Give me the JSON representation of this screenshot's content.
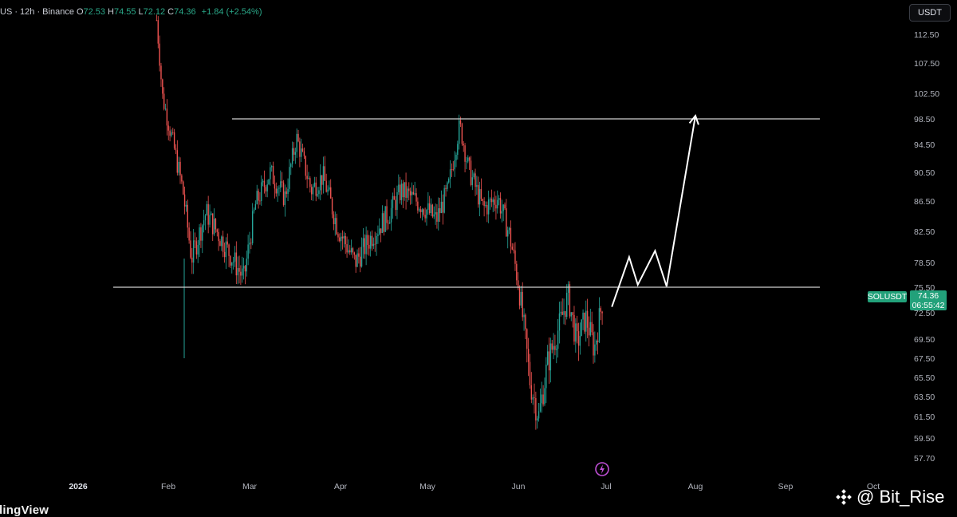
{
  "header": {
    "symbol_suffix": "US · 12h · Binance",
    "open_label": "O",
    "open": "72.53",
    "high_label": "H",
    "high": "74.55",
    "low_label": "L",
    "low": "72.12",
    "close_label": "C",
    "close": "74.36",
    "change": "+1.84 (+2.54%)"
  },
  "currency": "USDT",
  "price_tag": {
    "symbol": "SOLUSDT",
    "price": "74.36",
    "countdown": "06:55:42"
  },
  "brand": "dingView",
  "watermark": {
    "handle": "@ Bit_Rise",
    "icon": "binance-logo-icon"
  },
  "colors": {
    "up": "#26a69a",
    "down": "#ef5350",
    "level_line": "#d0d0d0",
    "projection": "#ffffff",
    "badge": "#22a17a"
  },
  "chart_data": {
    "type": "candlestick",
    "interval": "12h",
    "y_axis_ticks": [
      "112.50",
      "107.50",
      "102.50",
      "98.50",
      "94.50",
      "90.50",
      "86.50",
      "82.50",
      "78.50",
      "75.50",
      "72.50",
      "69.50",
      "67.50",
      "65.50",
      "63.50",
      "61.50",
      "59.50",
      "57.70"
    ],
    "x_axis_ticks": [
      "2026",
      "Feb",
      "Mar",
      "Apr",
      "May",
      "Jun",
      "Jul",
      "Aug",
      "Sep",
      "Oct"
    ],
    "horizontal_levels": [
      {
        "name": "resistance",
        "price": 98.5
      },
      {
        "name": "support",
        "price": 75.5
      }
    ],
    "projection_path": [
      {
        "date": "2026-07-03",
        "price": 73.2
      },
      {
        "date": "2026-07-09",
        "price": 79.2
      },
      {
        "date": "2026-07-12",
        "price": 75.8
      },
      {
        "date": "2026-07-18",
        "price": 80.0
      },
      {
        "date": "2026-07-22",
        "price": 75.6
      },
      {
        "date": "2026-08-01",
        "price": 99.0
      }
    ],
    "price_anchors": [
      {
        "date": "2026-01-28",
        "price": 115.0
      },
      {
        "date": "2026-01-30",
        "price": 102.0
      },
      {
        "date": "2026-02-02",
        "price": 96.0
      },
      {
        "date": "2026-02-06",
        "price": 88.0
      },
      {
        "date": "2026-02-09",
        "price": 79.0
      },
      {
        "date": "2026-02-14",
        "price": 85.0
      },
      {
        "date": "2026-02-20",
        "price": 81.0
      },
      {
        "date": "2026-02-27",
        "price": 76.5
      },
      {
        "date": "2026-03-03",
        "price": 86.0
      },
      {
        "date": "2026-03-08",
        "price": 90.5
      },
      {
        "date": "2026-03-13",
        "price": 87.0
      },
      {
        "date": "2026-03-17",
        "price": 95.5
      },
      {
        "date": "2026-03-22",
        "price": 88.0
      },
      {
        "date": "2026-03-26",
        "price": 90.0
      },
      {
        "date": "2026-03-31",
        "price": 83.0
      },
      {
        "date": "2026-04-06",
        "price": 78.5
      },
      {
        "date": "2026-04-12",
        "price": 82.0
      },
      {
        "date": "2026-04-18",
        "price": 85.0
      },
      {
        "date": "2026-04-22",
        "price": 88.0
      },
      {
        "date": "2026-04-29",
        "price": 86.0
      },
      {
        "date": "2026-05-04",
        "price": 84.0
      },
      {
        "date": "2026-05-08",
        "price": 88.0
      },
      {
        "date": "2026-05-12",
        "price": 97.5
      },
      {
        "date": "2026-05-15",
        "price": 91.0
      },
      {
        "date": "2026-05-20",
        "price": 85.5
      },
      {
        "date": "2026-05-25",
        "price": 87.0
      },
      {
        "date": "2026-05-29",
        "price": 82.0
      },
      {
        "date": "2026-06-01",
        "price": 76.0
      },
      {
        "date": "2026-06-05",
        "price": 65.0
      },
      {
        "date": "2026-06-08",
        "price": 61.5
      },
      {
        "date": "2026-06-11",
        "price": 67.0
      },
      {
        "date": "2026-06-15",
        "price": 71.0
      },
      {
        "date": "2026-06-18",
        "price": 74.5
      },
      {
        "date": "2026-06-21",
        "price": 69.0
      },
      {
        "date": "2026-06-24",
        "price": 72.0
      },
      {
        "date": "2026-06-27",
        "price": 68.5
      },
      {
        "date": "2026-06-30",
        "price": 74.36
      }
    ]
  }
}
